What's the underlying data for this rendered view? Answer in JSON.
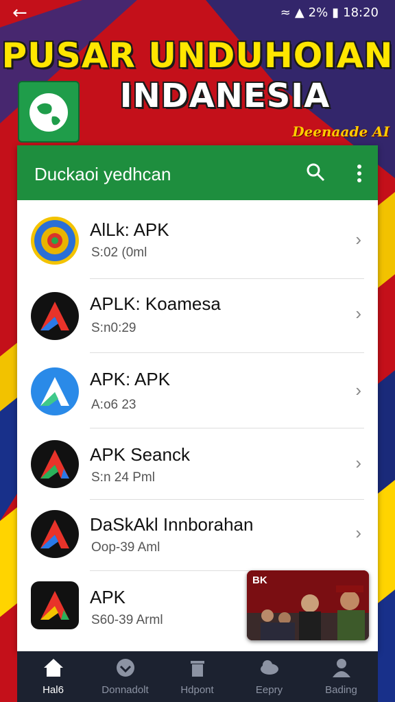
{
  "status_bar": {
    "battery": "2%",
    "time": "18:20"
  },
  "banner": {
    "title_line1": "PUSAR UNDUHOIAN",
    "title_line2": "INDANESIA",
    "tagline": "Deenaade AI"
  },
  "app_bar": {
    "title": "Duckaoi yedhcan"
  },
  "items": [
    {
      "title": "AlLk: APK",
      "subtitle": "S:02 (0ml"
    },
    {
      "title": "APLK: Koamesa",
      "subtitle": "S:n0:29"
    },
    {
      "title": "APK: APK",
      "subtitle": "A:o6 23"
    },
    {
      "title": "APK Seanck",
      "subtitle": "S:n 24 Pml"
    },
    {
      "title": "DaSkAkl Innborahan",
      "subtitle": "Oop-39 Aml"
    },
    {
      "title": "APK",
      "subtitle": "S60-39 Arml"
    }
  ],
  "thumbnail": {
    "label": "BK"
  },
  "bottom_nav": [
    {
      "label": "Hal6",
      "icon": "home-icon",
      "active": true
    },
    {
      "label": "Donnadolt",
      "icon": "download-icon",
      "active": false
    },
    {
      "label": "Hdpont",
      "icon": "trash-icon",
      "active": false
    },
    {
      "label": "Eepry",
      "icon": "cloud-icon",
      "active": false
    },
    {
      "label": "Bading",
      "icon": "profile-icon",
      "active": false
    }
  ],
  "colors": {
    "background": "#c4101a",
    "app_bar": "#1e8e3e",
    "title_yellow": "#ffe600",
    "bottom_nav": "#1c2230"
  }
}
